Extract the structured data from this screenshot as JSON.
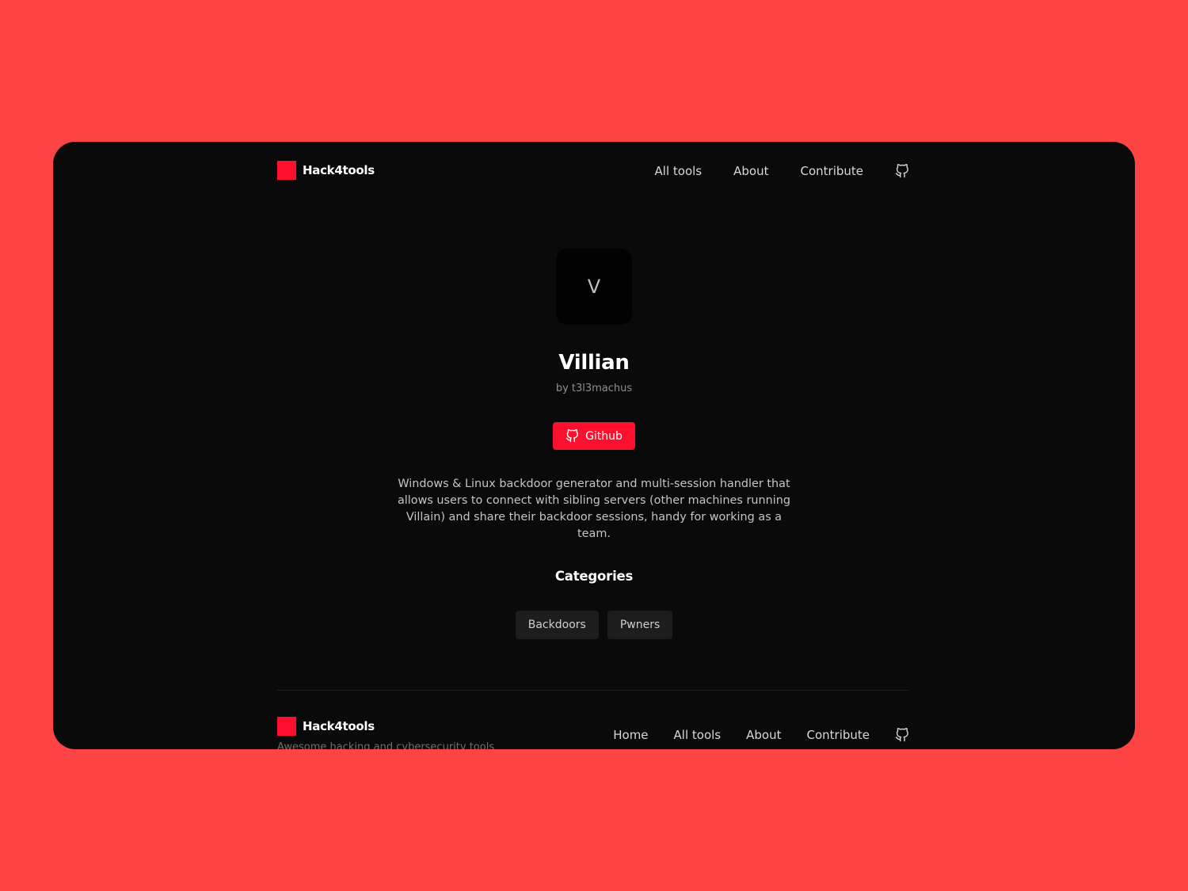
{
  "colors": {
    "background": "#fc4445",
    "window": "#0a0a0a",
    "accent": "#ff0f2e",
    "tag": "#1d1d1d"
  },
  "header": {
    "brand": "Hack4tools",
    "nav": [
      "All tools",
      "About",
      "Contribute"
    ],
    "icon": "github-icon"
  },
  "tool": {
    "icon_letter": "V",
    "name": "Villian",
    "author": "by t3l3machus",
    "github_button": "Github",
    "description": "Windows & Linux backdoor generator and multi-session handler that allows users to connect with sibling servers (other machines running Villain) and share their backdoor sessions, handy for working as a team.",
    "categories_heading": "Categories",
    "categories": [
      "Backdoors",
      "Pwners"
    ]
  },
  "footer": {
    "brand": "Hack4tools",
    "tagline": "Awesome hacking and cybersecurity tools",
    "nav": [
      "Home",
      "All tools",
      "About",
      "Contribute"
    ],
    "icon": "github-icon"
  }
}
